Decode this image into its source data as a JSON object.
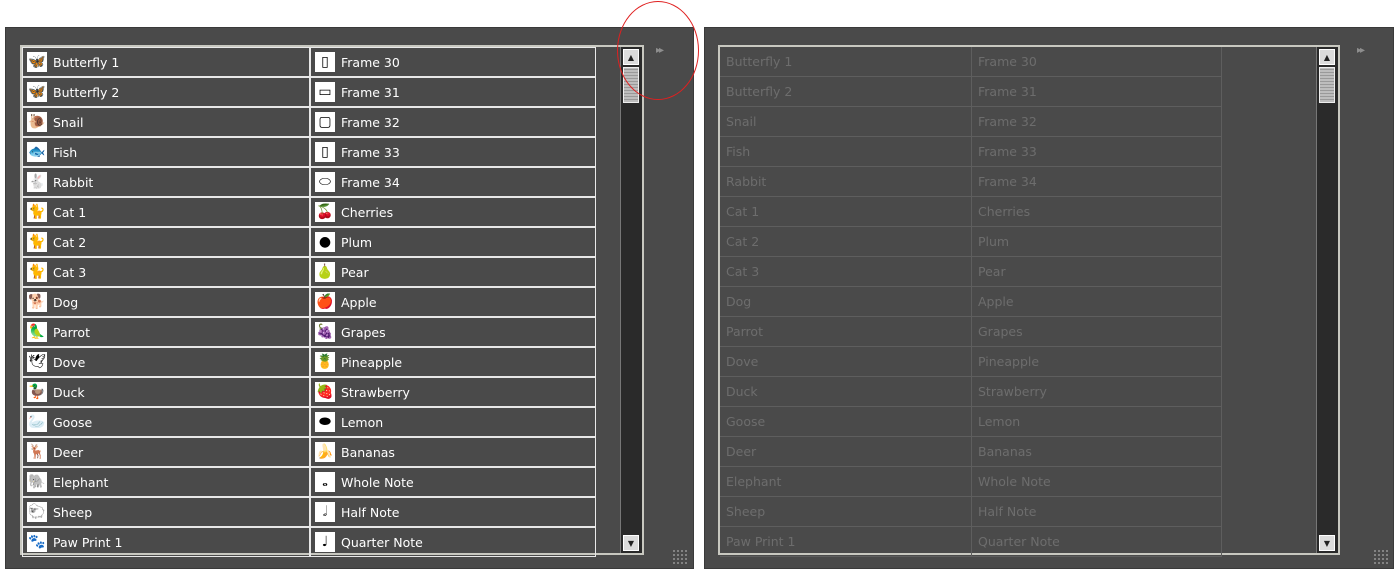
{
  "left_list": {
    "col1": [
      {
        "label": "Butterfly 1",
        "icon": "butterfly-icon",
        "glyph": "🦋"
      },
      {
        "label": "Butterfly 2",
        "icon": "butterfly-icon",
        "glyph": "🦋"
      },
      {
        "label": "Snail",
        "icon": "snail-icon",
        "glyph": "🐌"
      },
      {
        "label": "Fish",
        "icon": "fish-icon",
        "glyph": "🐟"
      },
      {
        "label": "Rabbit",
        "icon": "rabbit-icon",
        "glyph": "🐇"
      },
      {
        "label": "Cat 1",
        "icon": "cat-icon",
        "glyph": "🐈"
      },
      {
        "label": "Cat 2",
        "icon": "cat-icon",
        "glyph": "🐈"
      },
      {
        "label": "Cat 3",
        "icon": "cat-icon",
        "glyph": "🐈"
      },
      {
        "label": "Dog",
        "icon": "dog-icon",
        "glyph": "🐕"
      },
      {
        "label": "Parrot",
        "icon": "parrot-icon",
        "glyph": "🦜"
      },
      {
        "label": "Dove",
        "icon": "dove-icon",
        "glyph": "🕊"
      },
      {
        "label": "Duck",
        "icon": "duck-icon",
        "glyph": "🦆"
      },
      {
        "label": "Goose",
        "icon": "goose-icon",
        "glyph": "🦢"
      },
      {
        "label": "Deer",
        "icon": "deer-icon",
        "glyph": "🦌"
      },
      {
        "label": "Elephant",
        "icon": "elephant-icon",
        "glyph": "🐘"
      },
      {
        "label": "Sheep",
        "icon": "sheep-icon",
        "glyph": "🐑"
      },
      {
        "label": "Paw Print 1",
        "icon": "paw-print-icon",
        "glyph": "🐾"
      }
    ],
    "col2": [
      {
        "label": "Frame 30",
        "icon": "frame-icon",
        "glyph": "▯"
      },
      {
        "label": "Frame 31",
        "icon": "frame-icon",
        "glyph": "▭"
      },
      {
        "label": "Frame 32",
        "icon": "frame-icon",
        "glyph": "▢"
      },
      {
        "label": "Frame 33",
        "icon": "frame-icon",
        "glyph": "▯"
      },
      {
        "label": "Frame 34",
        "icon": "oval-frame-icon",
        "glyph": "⬭"
      },
      {
        "label": "Cherries",
        "icon": "cherries-icon",
        "glyph": "🍒"
      },
      {
        "label": "Plum",
        "icon": "plum-icon",
        "glyph": "●"
      },
      {
        "label": "Pear",
        "icon": "pear-icon",
        "glyph": "🍐"
      },
      {
        "label": "Apple",
        "icon": "apple-icon",
        "glyph": "🍎"
      },
      {
        "label": "Grapes",
        "icon": "grapes-icon",
        "glyph": "🍇"
      },
      {
        "label": "Pineapple",
        "icon": "pineapple-icon",
        "glyph": "🍍"
      },
      {
        "label": "Strawberry",
        "icon": "strawberry-icon",
        "glyph": "🍓"
      },
      {
        "label": "Lemon",
        "icon": "lemon-icon",
        "glyph": "⬬"
      },
      {
        "label": "Bananas",
        "icon": "bananas-icon",
        "glyph": "🍌"
      },
      {
        "label": "Whole Note",
        "icon": "whole-note-icon",
        "glyph": "𝅝"
      },
      {
        "label": "Half Note",
        "icon": "half-note-icon",
        "glyph": "𝅗𝅥"
      },
      {
        "label": "Quarter Note",
        "icon": "quarter-note-icon",
        "glyph": "♩"
      }
    ]
  },
  "right_list": {
    "col1": [
      "Butterfly 1",
      "Butterfly 2",
      "Snail",
      "Fish",
      "Rabbit",
      "Cat 1",
      "Cat 2",
      "Cat 3",
      "Dog",
      "Parrot",
      "Dove",
      "Duck",
      "Goose",
      "Deer",
      "Elephant",
      "Sheep",
      "Paw Print 1"
    ],
    "col2": [
      "Frame 30",
      "Frame 31",
      "Frame 32",
      "Frame 33",
      "Frame 34",
      "Cherries",
      "Plum",
      "Pear",
      "Apple",
      "Grapes",
      "Pineapple",
      "Strawberry",
      "Lemon",
      "Bananas",
      "Whole Note",
      "Half Note",
      "Quarter Note"
    ]
  },
  "controls": {
    "expand_glyph": "▸▸",
    "scroll_up_glyph": "▲",
    "scroll_down_glyph": "▼"
  },
  "colors": {
    "panel_bg": "#4a4a4a",
    "annotation_circle": "#e02020"
  }
}
